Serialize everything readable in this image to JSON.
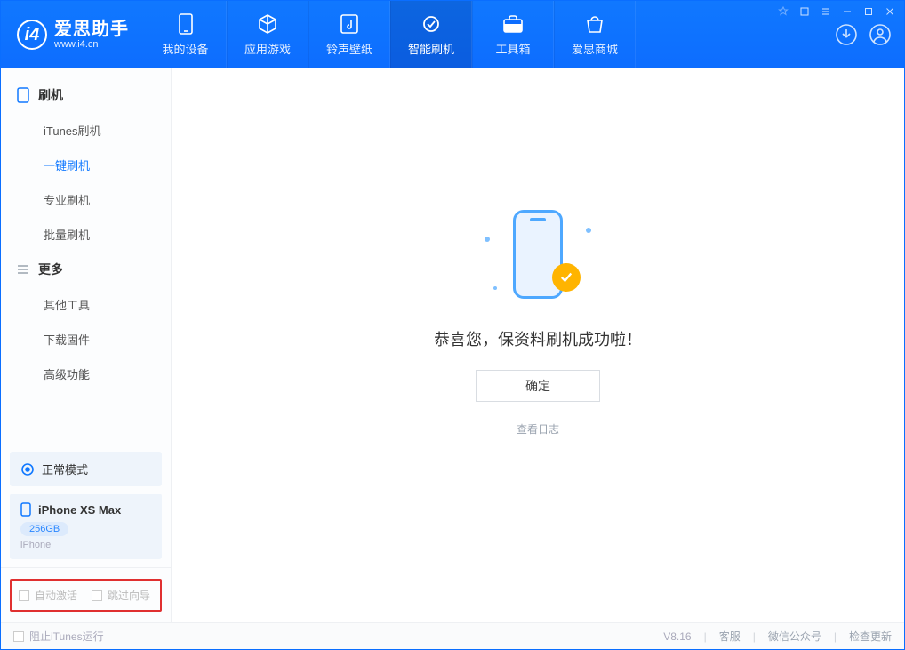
{
  "app": {
    "title": "爱思助手",
    "url": "www.i4.cn"
  },
  "tabs": [
    {
      "label": "我的设备"
    },
    {
      "label": "应用游戏"
    },
    {
      "label": "铃声壁纸"
    },
    {
      "label": "智能刷机"
    },
    {
      "label": "工具箱"
    },
    {
      "label": "爱思商城"
    }
  ],
  "sidebar": {
    "sec1": {
      "title": "刷机",
      "items": [
        "iTunes刷机",
        "一键刷机",
        "专业刷机",
        "批量刷机"
      ]
    },
    "sec2": {
      "title": "更多",
      "items": [
        "其他工具",
        "下载固件",
        "高级功能"
      ]
    },
    "mode": "正常模式",
    "device": {
      "name": "iPhone XS Max",
      "capacity": "256GB",
      "type": "iPhone"
    },
    "auto_activate": "自动激活",
    "skip_guide": "跳过向导"
  },
  "main": {
    "success_msg": "恭喜您，保资料刷机成功啦！",
    "ok": "确定",
    "view_log": "查看日志"
  },
  "statusbar": {
    "block_itunes": "阻止iTunes运行",
    "version": "V8.16",
    "support": "客服",
    "wechat": "微信公众号",
    "update": "检查更新"
  }
}
